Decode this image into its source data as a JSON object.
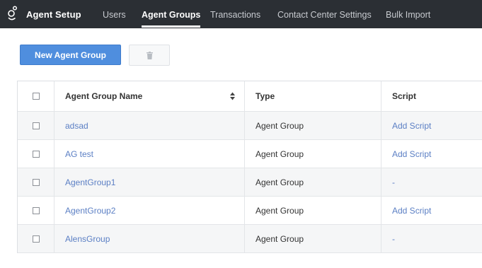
{
  "header": {
    "app_title": "Agent Setup",
    "nav": [
      {
        "label": "Users"
      },
      {
        "label": "Agent Groups"
      },
      {
        "label": "Transactions"
      },
      {
        "label": "Contact Center Settings"
      },
      {
        "label": "Bulk Import"
      }
    ],
    "active_nav": "Agent Groups"
  },
  "toolbar": {
    "new_label": "New Agent Group",
    "delete_icon": "trash-icon"
  },
  "table": {
    "columns": [
      "Agent Group Name",
      "Type",
      "Script"
    ],
    "sort_column": "Agent Group Name",
    "rows": [
      {
        "name": "adsad",
        "type": "Agent Group",
        "script": "Add Script"
      },
      {
        "name": "AG test",
        "type": "Agent Group",
        "script": "Add Script"
      },
      {
        "name": "AgentGroup1",
        "type": "Agent Group",
        "script": "-"
      },
      {
        "name": "AgentGroup2",
        "type": "Agent Group",
        "script": "Add Script"
      },
      {
        "name": "AlensGroup",
        "type": "Agent Group",
        "script": "-"
      }
    ]
  },
  "colors": {
    "topbar": "#2b2f34",
    "primary_button": "#4f8ede",
    "link": "#5b7fc4",
    "row_alt": "#f5f6f7"
  }
}
